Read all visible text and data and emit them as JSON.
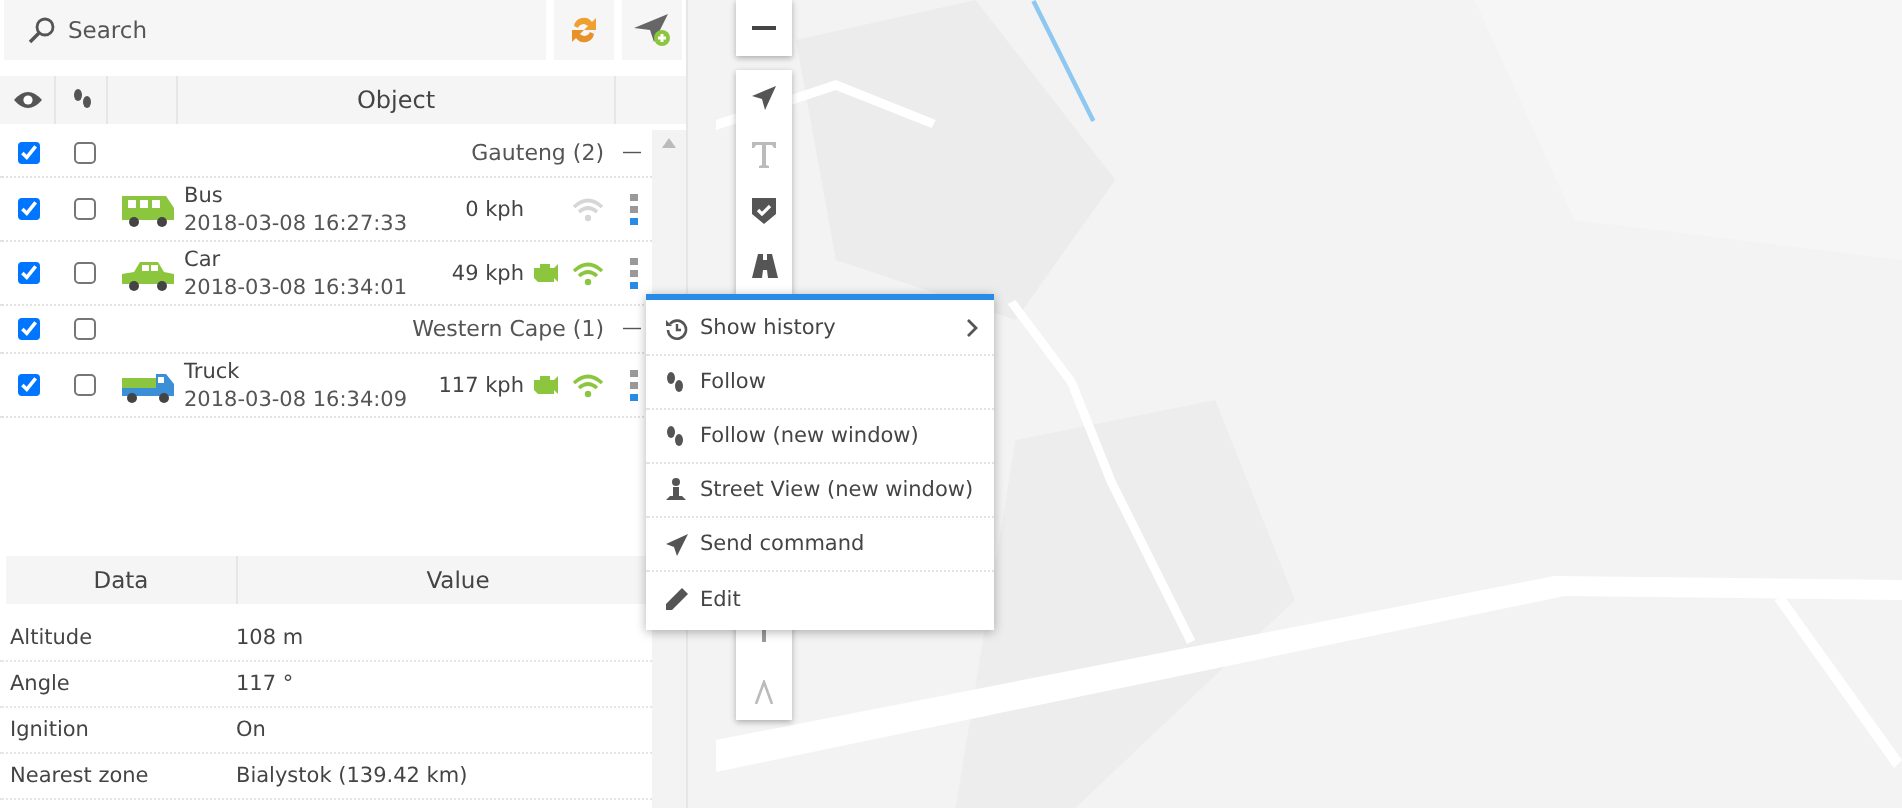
{
  "search": {
    "placeholder": "Search"
  },
  "object_table": {
    "columns": [
      "Object"
    ],
    "groups": [
      {
        "name": "Gauteng (2)",
        "visible": true,
        "follow": false,
        "collapse_symbol": "—",
        "children": [
          {
            "name": "Bus",
            "kind": "bus",
            "time": "2018-03-08 16:27:33",
            "speed": "0 kph",
            "visible": true,
            "follow": false,
            "ignition": false,
            "signal": false
          },
          {
            "name": "Car",
            "kind": "car",
            "time": "2018-03-08 16:34:01",
            "speed": "49 kph",
            "visible": true,
            "follow": false,
            "ignition": true,
            "signal": true
          }
        ]
      },
      {
        "name": "Western Cape (1)",
        "visible": true,
        "follow": false,
        "collapse_symbol": "—",
        "children": [
          {
            "name": "Truck",
            "kind": "truck",
            "time": "2018-03-08 16:34:09",
            "speed": "117 kph",
            "visible": true,
            "follow": false,
            "ignition": true,
            "signal": true
          }
        ]
      }
    ]
  },
  "data_table": {
    "columns": [
      "Data",
      "Value"
    ],
    "rows": [
      {
        "label": "Altitude",
        "value": "108 m"
      },
      {
        "label": "Angle",
        "value": "117 °"
      },
      {
        "label": "Ignition",
        "value": "On"
      },
      {
        "label": "Nearest zone",
        "value": "Bialystok (139.42 km)"
      }
    ]
  },
  "context_menu": {
    "items": [
      {
        "label": "Show history",
        "kind": "history",
        "submenu": true
      },
      {
        "label": "Follow",
        "kind": "follow",
        "submenu": false
      },
      {
        "label": "Follow (new window)",
        "kind": "follow",
        "submenu": false
      },
      {
        "label": "Street View (new window)",
        "kind": "streetview",
        "submenu": false
      },
      {
        "label": "Send command",
        "kind": "command",
        "submenu": false
      },
      {
        "label": "Edit",
        "kind": "edit",
        "submenu": false
      }
    ]
  }
}
